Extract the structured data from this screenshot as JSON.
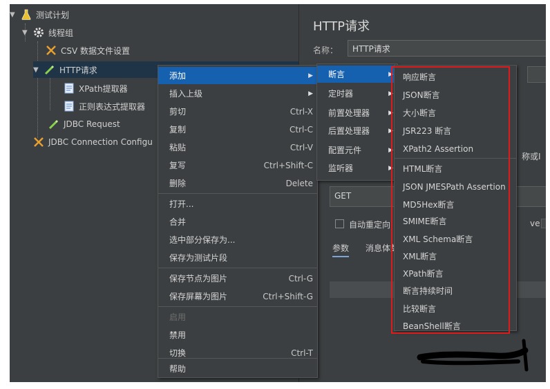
{
  "tree": {
    "root": "测试计划",
    "thread_group": "线程组",
    "csv": "CSV 数据文件设置",
    "http": "HTTP请求",
    "xpath_extractor": "XPath提取器",
    "regex_extractor": "正则表达式提取器",
    "jdbc_request": "JDBC Request",
    "jdbc_config": "JDBC Connection Configu"
  },
  "right_panel": {
    "title": "HTTP请求",
    "name_label": "名称：",
    "name_value": "HTTP请求",
    "partial_label": "称或I",
    "method": "GET",
    "auto_redirect": "自动重定向",
    "partial_ve": "ve",
    "tab_params": "参数",
    "tab_body": "消息体数"
  },
  "context_menu": [
    {
      "label": "添加",
      "shortcut": "",
      "submenu": true
    },
    {
      "label": "插入上级",
      "shortcut": "",
      "submenu": true
    },
    {
      "label": "剪切",
      "shortcut": "Ctrl-X"
    },
    {
      "label": "复制",
      "shortcut": "Ctrl-C"
    },
    {
      "label": "粘贴",
      "shortcut": "Ctrl-V"
    },
    {
      "label": "复写",
      "shortcut": "Ctrl+Shift-C"
    },
    {
      "label": "删除",
      "shortcut": "Delete"
    },
    {
      "label": "打开...",
      "shortcut": ""
    },
    {
      "label": "合并",
      "shortcut": ""
    },
    {
      "label": "选中部分保存为...",
      "shortcut": ""
    },
    {
      "label": "保存为测试片段",
      "shortcut": ""
    },
    {
      "label": "保存节点为图片",
      "shortcut": "Ctrl-G"
    },
    {
      "label": "保存屏幕为图片",
      "shortcut": "Ctrl+Shift-G"
    },
    {
      "label": "启用",
      "shortcut": ""
    },
    {
      "label": "禁用",
      "shortcut": ""
    },
    {
      "label": "切换",
      "shortcut": "Ctrl-T"
    },
    {
      "label": "帮助",
      "shortcut": ""
    }
  ],
  "add_submenu": [
    "断言",
    "定时器",
    "前置处理器",
    "后置处理器",
    "配置元件",
    "监听器"
  ],
  "assertion_submenu": [
    "响应断言",
    "JSON断言",
    "大小断言",
    "JSR223 断言",
    "XPath2 Assertion",
    "HTML断言",
    "JSON JMESPath Assertion",
    "MD5Hex断言",
    "SMIME断言",
    "XML Schema断言",
    "XML断言",
    "XPath断言",
    "断言持续时间",
    "比较断言",
    "BeanShell断言"
  ],
  "colors": {
    "highlight_box": "#e01b1b",
    "selection": "#1660b0",
    "background": "#3c3f41"
  }
}
